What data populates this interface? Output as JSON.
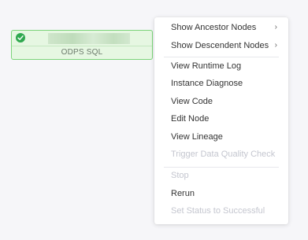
{
  "node": {
    "type_label": "ODPS SQL",
    "status": "success",
    "name_redacted": true
  },
  "context_menu": {
    "items": [
      {
        "label": "Show Ancestor Nodes",
        "submenu": true,
        "disabled": false
      },
      {
        "label": "Show Descendent Nodes",
        "submenu": true,
        "disabled": false
      },
      {
        "label": "View Runtime Log",
        "submenu": false,
        "disabled": false
      },
      {
        "label": "Instance Diagnose",
        "submenu": false,
        "disabled": false
      },
      {
        "label": "View Code",
        "submenu": false,
        "disabled": false
      },
      {
        "label": "Edit Node",
        "submenu": false,
        "disabled": false
      },
      {
        "label": "View Lineage",
        "submenu": false,
        "disabled": false
      },
      {
        "label": "Trigger Data Quality Check",
        "submenu": false,
        "disabled": true
      },
      {
        "label": "Stop",
        "submenu": false,
        "disabled": true
      },
      {
        "label": "Rerun",
        "submenu": false,
        "disabled": false
      },
      {
        "label": "Set Status to Successful",
        "submenu": false,
        "disabled": true
      }
    ],
    "submenu_arrow": "›"
  },
  "colors": {
    "success": "#2fa84f",
    "node_border": "#7cd47a",
    "node_bg": "#e6f7e2",
    "disabled_text": "#c4c6cf"
  },
  "icons": {
    "status": "check-circle-icon",
    "submenu": "chevron-right-icon"
  }
}
